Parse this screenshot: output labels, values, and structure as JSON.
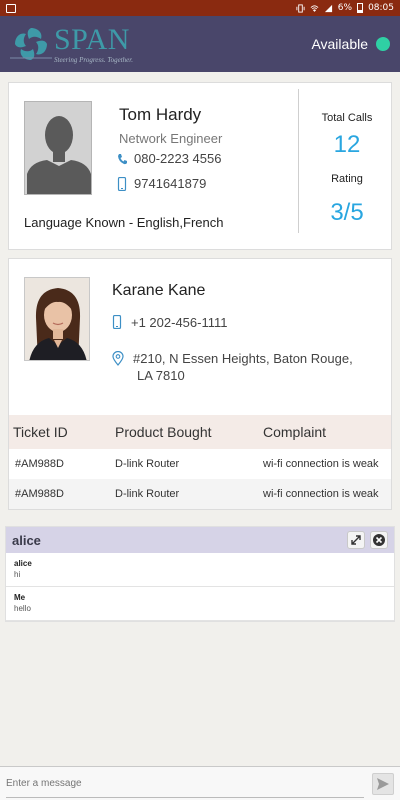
{
  "statusbar": {
    "battery": "6%",
    "time": "08:05"
  },
  "header": {
    "logo_name": "SPAN",
    "logo_tagline": "Steering Progress. Together.",
    "availability": "Available",
    "availability_color": "#2fd0a4"
  },
  "agent": {
    "name": "Tom Hardy",
    "role": "Network Engineer",
    "phone": "080-2223 4556",
    "mobile": "9741641879",
    "languages": "Language Known - English,French",
    "total_calls_label": "Total Calls",
    "total_calls": "12",
    "rating_label": "Rating",
    "rating": "3/5"
  },
  "customer": {
    "name": "Karane Kane",
    "phone": "+1 202-456-1111",
    "address_line1": "#210, N Essen Heights, Baton Rouge,",
    "address_line2": "LA 7810"
  },
  "tickets": {
    "columns": [
      "Ticket ID",
      "Product Bought",
      "Complaint"
    ],
    "rows": [
      [
        "#AM988D",
        "D-link Router",
        "wi-fi connection is weak"
      ],
      [
        "#AM988D",
        "D-link Router",
        "wi-fi connection is weak"
      ]
    ]
  },
  "chat": {
    "title": "alice",
    "messages": [
      {
        "sender": "alice",
        "text": "hi"
      },
      {
        "sender": "Me",
        "text": "hello"
      }
    ]
  },
  "composer": {
    "placeholder": "Enter a message"
  },
  "colors": {
    "accent": "#29a6e0",
    "header_bg": "#49466a",
    "statusbar_bg": "#8a2a10"
  }
}
